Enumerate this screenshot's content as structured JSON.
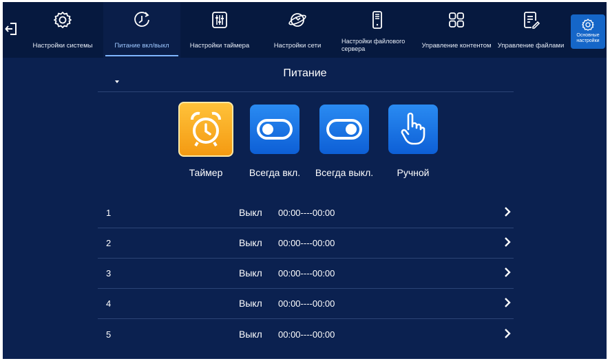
{
  "topbar": {
    "nav": [
      {
        "label": "Настройки системы",
        "icon": "gear-icon"
      },
      {
        "label": "Питание вкл/выкл",
        "icon": "power-timer-icon",
        "active": true
      },
      {
        "label": "Настройки таймера",
        "icon": "sliders-icon"
      },
      {
        "label": "Настройки сети",
        "icon": "network-globe-icon"
      },
      {
        "label": "Настройки файлового сервера",
        "icon": "server-icon"
      },
      {
        "label": "Управление контентом",
        "icon": "grid-icon"
      },
      {
        "label": "Управление файлами",
        "icon": "file-edit-icon"
      }
    ],
    "basic_settings": {
      "label": "Основные настройки",
      "icon": "gear-icon"
    }
  },
  "main": {
    "title": "Питание",
    "modes": [
      {
        "label": "Таймер",
        "icon": "alarm-clock-icon",
        "selected": true
      },
      {
        "label": "Всегда вкл.",
        "icon": "toggle-on-icon"
      },
      {
        "label": "Всегда выкл.",
        "icon": "toggle-off-icon"
      },
      {
        "label": "Ручной",
        "icon": "hand-pointer-icon"
      }
    ],
    "schedule": [
      {
        "num": "1",
        "state": "Выкл",
        "time": "00:00----00:00"
      },
      {
        "num": "2",
        "state": "Выкл",
        "time": "00:00----00:00"
      },
      {
        "num": "3",
        "state": "Выкл",
        "time": "00:00----00:00"
      },
      {
        "num": "4",
        "state": "Выкл",
        "time": "00:00----00:00"
      },
      {
        "num": "5",
        "state": "Выкл",
        "time": "00:00----00:00"
      }
    ]
  },
  "colors": {
    "background": "#0b2150",
    "topbar": "#06193f",
    "accent": "#1566c8",
    "timer_tile": "#f7a51b"
  }
}
